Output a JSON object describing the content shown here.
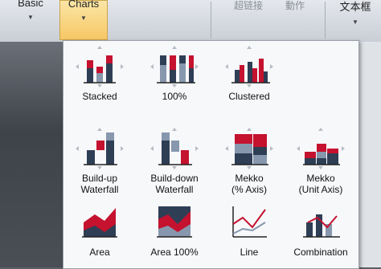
{
  "ribbon": {
    "basic_label": "Basic",
    "charts_label": "Charts",
    "group3_label": "超链接",
    "group4_label": "動作",
    "group5_label": "文本框"
  },
  "gallery": {
    "items": [
      {
        "label": "Stacked"
      },
      {
        "label": "100%"
      },
      {
        "label": "Clustered"
      },
      {
        "label": "Build-up\nWaterfall"
      },
      {
        "label": "Build-down\nWaterfall"
      },
      {
        "label": "Mekko\n(% Axis)"
      },
      {
        "label": "Mekko\n(Unit Axis)"
      },
      {
        "label": "Area"
      },
      {
        "label": "Area 100%"
      },
      {
        "label": "Line"
      },
      {
        "label": "Combination"
      }
    ]
  },
  "colors": {
    "red": "#c4122f",
    "navy": "#2e3e55",
    "slate": "#8797ad",
    "handle": "#b7bcc3"
  }
}
